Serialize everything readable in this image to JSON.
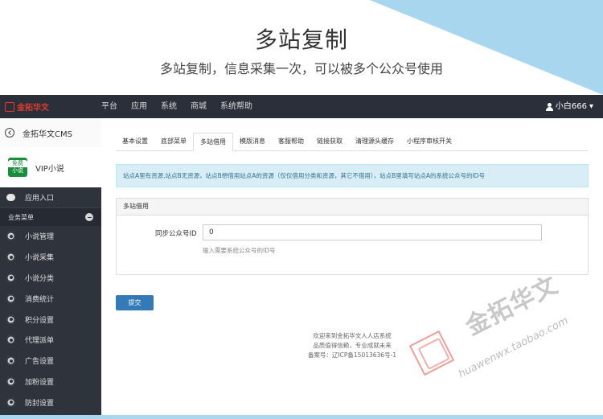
{
  "banner": {
    "title": "多站复制",
    "subtitle": "多站复制，信息采集一次，可以被多个公众号使用"
  },
  "topnav": {
    "logo_text": "金拓华文",
    "items": [
      "平台",
      "应用",
      "系统",
      "商城",
      "系统帮助"
    ],
    "user": "小白666",
    "user_caret": "▾"
  },
  "sidebar": {
    "back_label": "金拓华文CMS",
    "site_logo_top": "免费",
    "site_logo_bottom": "小说",
    "site_name": "VIP小说",
    "entry_label": "应用入口",
    "section_label": "业务菜单",
    "items": [
      "小说管理",
      "小说采集",
      "小说分类",
      "消费统计",
      "积分设置",
      "代理派单",
      "广告设置",
      "加粉设置",
      "防封设置"
    ]
  },
  "main": {
    "tabs": [
      "基本设置",
      "底部菜单",
      "多站借用",
      "模版消息",
      "客服帮助",
      "链接获取",
      "清理源头缓存",
      "小程序审核开关"
    ],
    "active_tab_index": 2,
    "alert": "站点A里有资源,站点B无资源，站点B想借用站点A的资源（仅仅借用分类和资源，其它不借用），站点B里填写站点A的系统公众号的ID号",
    "panel_title": "多站借用",
    "field_label": "同步公众号ID",
    "field_value": "0",
    "field_help": "输入需要系统公众号的ID号",
    "submit_label": "提交",
    "footer_lines": [
      "欢迎来到金拓华文人人店系统",
      "品质值得信赖，专业成就未来",
      "备案号：辽ICP备15013636号-1"
    ]
  },
  "watermark": {
    "brand": "金拓华文",
    "url": "huawenwx.taobao.com"
  },
  "colors": {
    "nav_bg": "#2b2f3a",
    "sidebar_bg": "#2e333c",
    "accent_blue": "#337ab7",
    "banner_blue": "#a8d6ef",
    "alert_bg": "#d9edf7"
  }
}
